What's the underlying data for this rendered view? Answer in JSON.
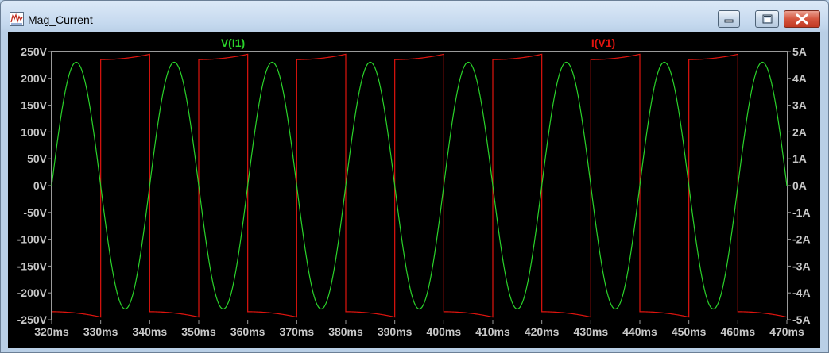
{
  "window": {
    "title": "Mag_Current",
    "app_icon": "waveform-icon",
    "buttons": {
      "minimize": "minimize-icon",
      "maximize": "maximize-icon",
      "close": "close-icon"
    }
  },
  "colors": {
    "background": "#000000",
    "axis_labels": "#c8c8c8",
    "voltage_trace": "#2ad32a",
    "current_trace": "#e0140e"
  },
  "chart_data": {
    "type": "line",
    "title": "",
    "xlabel": "",
    "x_unit": "ms",
    "xlim": [
      320,
      470
    ],
    "x_ticks": [
      "320ms",
      "330ms",
      "340ms",
      "350ms",
      "360ms",
      "370ms",
      "380ms",
      "390ms",
      "400ms",
      "410ms",
      "420ms",
      "430ms",
      "440ms",
      "450ms",
      "460ms",
      "470ms"
    ],
    "y_left": {
      "lim": [
        -250,
        250
      ],
      "ticks": [
        "250V",
        "200V",
        "150V",
        "100V",
        "50V",
        "0V",
        "-50V",
        "-100V",
        "-150V",
        "-200V",
        "-250V"
      ]
    },
    "y_right": {
      "lim": [
        -5,
        5
      ],
      "ticks": [
        "5A",
        "4A",
        "3A",
        "2A",
        "1A",
        "0A",
        "-1A",
        "-2A",
        "-3A",
        "-4A",
        "-5A"
      ]
    },
    "grid": false,
    "series": [
      {
        "name": "V(I1)",
        "axis": "left",
        "color": "#2ad32a",
        "waveform": "sine",
        "amplitude": 230,
        "period_ms": 20,
        "zero_crossing_rising_ms": 320,
        "peak_times_ms": [
          325,
          345,
          365,
          385,
          405,
          425,
          445,
          465
        ],
        "peak_value": 230,
        "trough_value": -230
      },
      {
        "name": "I(V1)",
        "axis": "right",
        "color": "#e0140e",
        "waveform": "square",
        "period_ms": 20,
        "high_level": 4.7,
        "high_level_end": 4.9,
        "low_level": -4.7,
        "low_level_end": -4.9,
        "rising_edges_ms": [
          330,
          350,
          370,
          390,
          410,
          430,
          450
        ],
        "falling_edges_ms": [
          340,
          360,
          380,
          400,
          420,
          440,
          460
        ]
      }
    ]
  }
}
